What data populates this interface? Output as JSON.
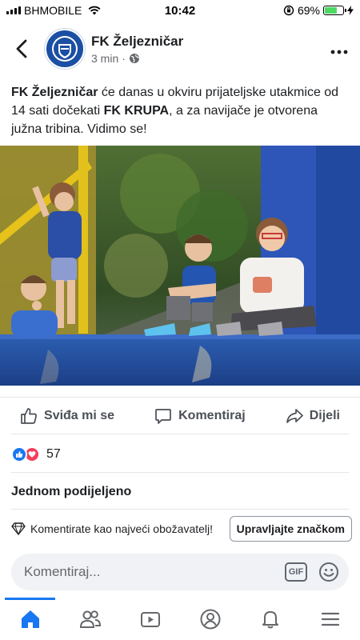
{
  "status_bar": {
    "carrier": "BHMOBILE",
    "time": "10:42",
    "battery": "69%",
    "battery_level": 0.69
  },
  "post": {
    "page_name": "FK Željezničar",
    "time_ago": "3 min",
    "separator": "·",
    "text_parts": {
      "team": "FK Željezničar",
      "middle": " će danas u okviru prijateljske utakmice od 14 sati dočekati ",
      "opponent": "FK KRUPA",
      "end": ", a za navijače je otvorena južna tribina. Vidimo se!"
    }
  },
  "actions": {
    "like": "Sviđa mi se",
    "comment": "Komentiraj",
    "share": "Dijeli"
  },
  "reactions": {
    "count": "57"
  },
  "shared": "Jednom podijeljeno",
  "fan": {
    "text": "Komentirate kao najveći obožavatelj!",
    "button": "Upravljajte značkom"
  },
  "comment_box": {
    "placeholder": "Komentiraj...",
    "gif": "GIF"
  },
  "colors": {
    "accent": "#1877f2",
    "love": "#f33e58",
    "club_blue": "#1a4fa3"
  },
  "tabbar": [
    "home-icon",
    "friends-icon",
    "watch-icon",
    "profile-icon",
    "notifications-icon",
    "menu-icon"
  ]
}
